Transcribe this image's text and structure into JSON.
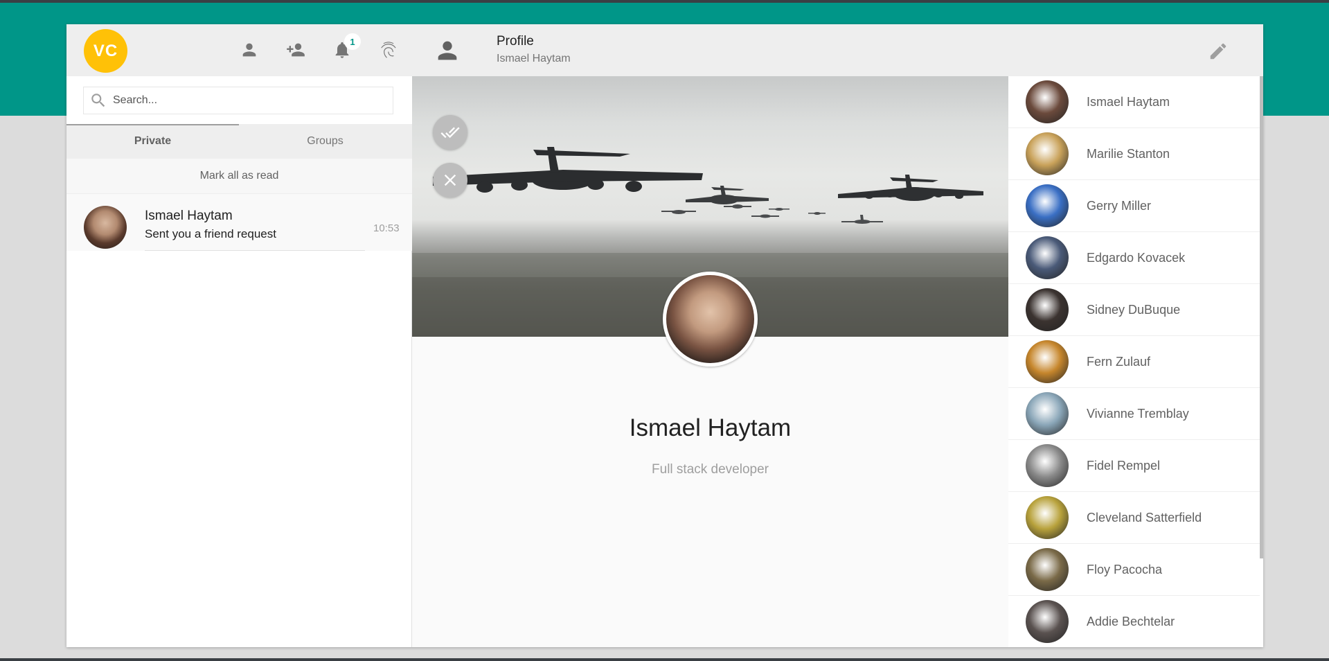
{
  "header": {
    "avatar_initials": "VC",
    "notification_count": "1",
    "icons": [
      "person-icon",
      "add-person-icon",
      "bell-icon",
      "fingerprint-icon"
    ]
  },
  "search": {
    "placeholder": "Search..."
  },
  "tabs": [
    {
      "label": "Private",
      "active": true
    },
    {
      "label": "Groups",
      "active": false
    }
  ],
  "mark_all_read": "Mark all as read",
  "notifications": [
    {
      "name": "Ismael Haytam",
      "message": "Sent you a friend request",
      "time": "10:53"
    }
  ],
  "profile": {
    "header_title": "Profile",
    "header_subtitle": "Ismael Haytam",
    "name": "Ismael Haytam",
    "role": "Full stack developer"
  },
  "contacts": [
    {
      "name": "Ismael Haytam",
      "color": "#6b4a3c"
    },
    {
      "name": "Marilie Stanton",
      "color": "#c9a25a"
    },
    {
      "name": "Gerry Miller",
      "color": "#3a6fc4"
    },
    {
      "name": "Edgardo Kovacek",
      "color": "#4a5a78"
    },
    {
      "name": "Sidney DuBuque",
      "color": "#3b3330"
    },
    {
      "name": "Fern Zulauf",
      "color": "#c6862c"
    },
    {
      "name": "Vivianne Tremblay",
      "color": "#8aa6b8"
    },
    {
      "name": "Fidel Rempel",
      "color": "#8a8a8a"
    },
    {
      "name": "Cleveland Satterfield",
      "color": "#b8a23c"
    },
    {
      "name": "Floy Pacocha",
      "color": "#7a6a48"
    },
    {
      "name": "Addie Bechtelar",
      "color": "#5a5250"
    }
  ]
}
